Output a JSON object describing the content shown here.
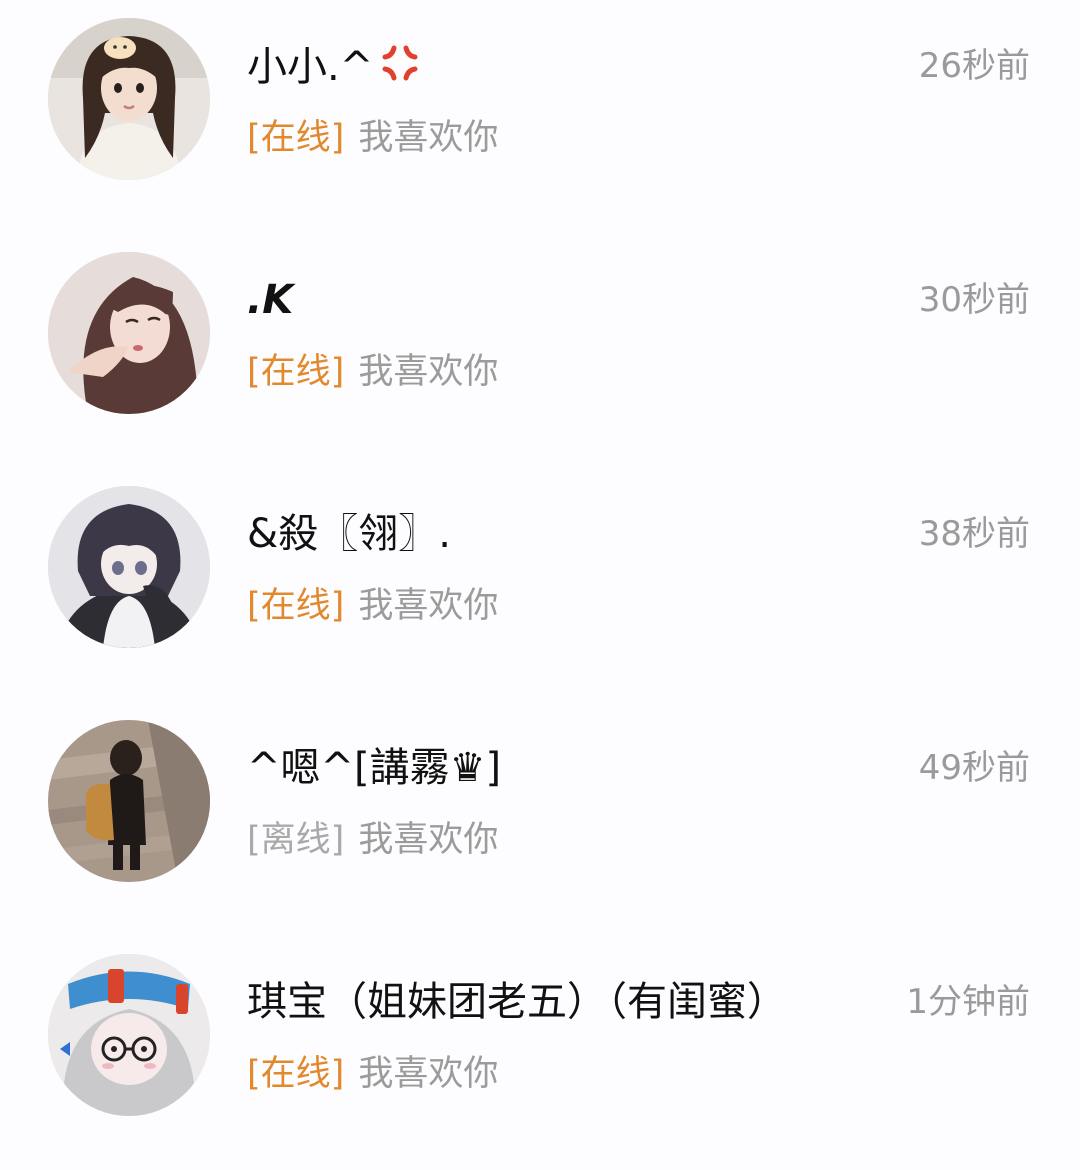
{
  "colors": {
    "online": "#e2892e",
    "offline": "#a9a9a9",
    "time": "#9a9a9a",
    "name": "#111111",
    "background": "#fdfcfe"
  },
  "conversations": [
    {
      "name": "小小.^",
      "name_icon": "anger-symbol-icon",
      "time": "26秒前",
      "status": "[在线]",
      "status_state": "online",
      "message": "我喜欢你",
      "avatar_icon": "girl-portrait-avatar-icon"
    },
    {
      "name": ".K",
      "time": "30秒前",
      "status": "[在线]",
      "status_state": "online",
      "message": "我喜欢你",
      "avatar_icon": "girl-portrait-avatar-icon"
    },
    {
      "name": "&殺〖翎〗.",
      "time": "38秒前",
      "status": "[在线]",
      "status_state": "online",
      "message": "我喜欢你",
      "avatar_icon": "anime-boy-avatar-icon"
    },
    {
      "name": "^嗯^[講霧♛]",
      "time": "49秒前",
      "status": "[离线]",
      "status_state": "offline",
      "message": "我喜欢你",
      "avatar_icon": "girl-backpack-avatar-icon"
    },
    {
      "name": "琪宝（姐妹团老五）（有闺蜜）",
      "time": "1分钟前",
      "status": "[在线]",
      "status_state": "online",
      "message": "我喜欢你",
      "avatar_icon": "cartoon-girl-avatar-icon"
    }
  ]
}
